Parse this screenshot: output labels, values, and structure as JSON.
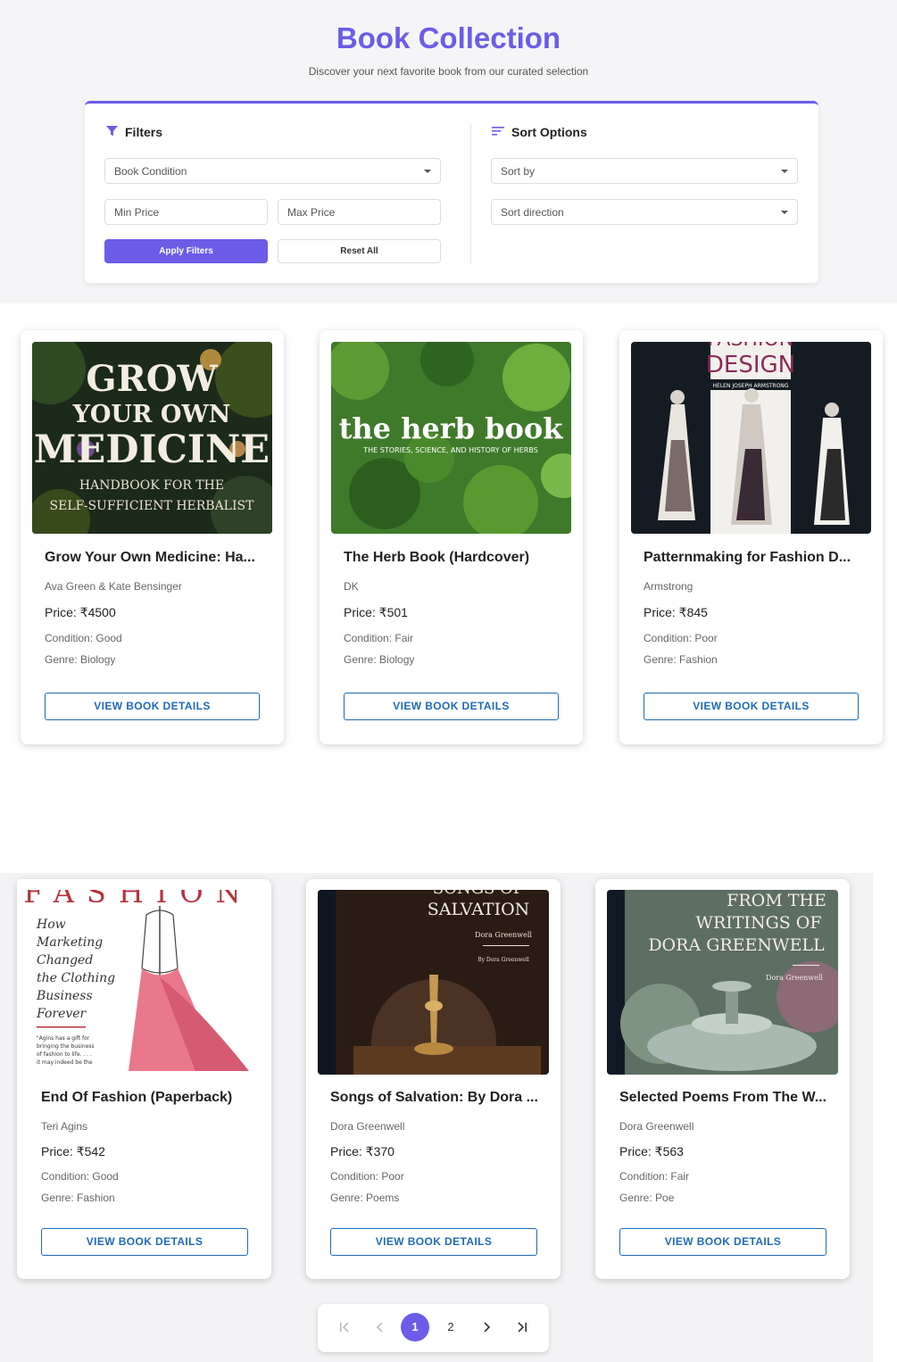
{
  "header": {
    "title": "Book Collection",
    "subtitle": "Discover your next favorite book from our curated selection"
  },
  "filters": {
    "title": "Filters",
    "condition_placeholder": "Book Condition",
    "min_price_placeholder": "Min Price",
    "max_price_placeholder": "Max Price",
    "apply_label": "Apply Filters",
    "reset_label": "Reset All"
  },
  "sort": {
    "title": "Sort Options",
    "sort_by_placeholder": "Sort by",
    "direction_placeholder": "Sort direction"
  },
  "books": [
    {
      "title": "Grow Your Own Medicine: Ha...",
      "author": "Ava Green & Kate Bensinger",
      "price": "Price: ₹4500",
      "condition": "Condition: Good",
      "genre": "Genre: Biology",
      "button": "VIEW BOOK DETAILS",
      "cover": {
        "lines": [
          "GROW",
          "YOUR OWN",
          "MEDICINE",
          "HANDBOOK FOR THE",
          "SELF-SUFFICIENT HERBALIST"
        ]
      }
    },
    {
      "title": "The Herb Book (Hardcover)",
      "author": "DK",
      "price": "Price: ₹501",
      "condition": "Condition: Fair",
      "genre": "Genre: Biology",
      "button": "VIEW BOOK DETAILS",
      "cover": {
        "lines": [
          "the herb book",
          "THE STORIES, SCIENCE, AND HISTORY OF HERBS"
        ]
      }
    },
    {
      "title": "Patternmaking for Fashion D...",
      "author": "Armstrong",
      "price": "Price: ₹845",
      "condition": "Condition: Poor",
      "genre": "Genre: Fashion",
      "button": "VIEW BOOK DETAILS",
      "cover": {
        "lines": [
          "FASHION",
          "DESIGN",
          "HELEN JOSEPH ARMSTRONG"
        ]
      }
    },
    {
      "title": "End Of Fashion (Paperback)",
      "author": "Teri Agins",
      "price": "Price: ₹542",
      "condition": "Condition: Good",
      "genre": "Genre: Fashion",
      "button": "VIEW BOOK DETAILS",
      "cover": {
        "lines": [
          "FASHION",
          "How",
          "Marketing",
          "Changed",
          "the Clothing",
          "Business",
          "Forever",
          "\"Agins has a gift for",
          "bringing the business",
          "of fashion to life. . . .",
          "it may indeed be the"
        ]
      }
    },
    {
      "title": "Songs of Salvation: By Dora ...",
      "author": "Dora Greenwell",
      "price": "Price: ₹370",
      "condition": "Condition: Poor",
      "genre": "Genre: Poems",
      "button": "VIEW BOOK DETAILS",
      "cover": {
        "lines": [
          "SONGS OF",
          "SALVATION",
          "Dora Greenwell",
          "By Dora Greenwell"
        ]
      }
    },
    {
      "title": "Selected Poems From The W...",
      "author": "Dora Greenwell",
      "price": "Price: ₹563",
      "condition": "Condition: Fair",
      "genre": "Genre: Poe",
      "button": "VIEW BOOK DETAILS",
      "cover": {
        "lines": [
          "FROM THE",
          "WRITINGS OF",
          "DORA GREENWELL",
          "Dora Greenwell"
        ]
      }
    }
  ],
  "pagination": {
    "first_icon": "first-page-icon",
    "prev_icon": "chevron-left-icon",
    "pages": [
      "1",
      "2"
    ],
    "current": "1",
    "next_icon": "chevron-right-icon",
    "last_icon": "last-page-icon"
  },
  "colors": {
    "accent": "#6c5ce7",
    "button_outline": "#1e6bb8"
  }
}
